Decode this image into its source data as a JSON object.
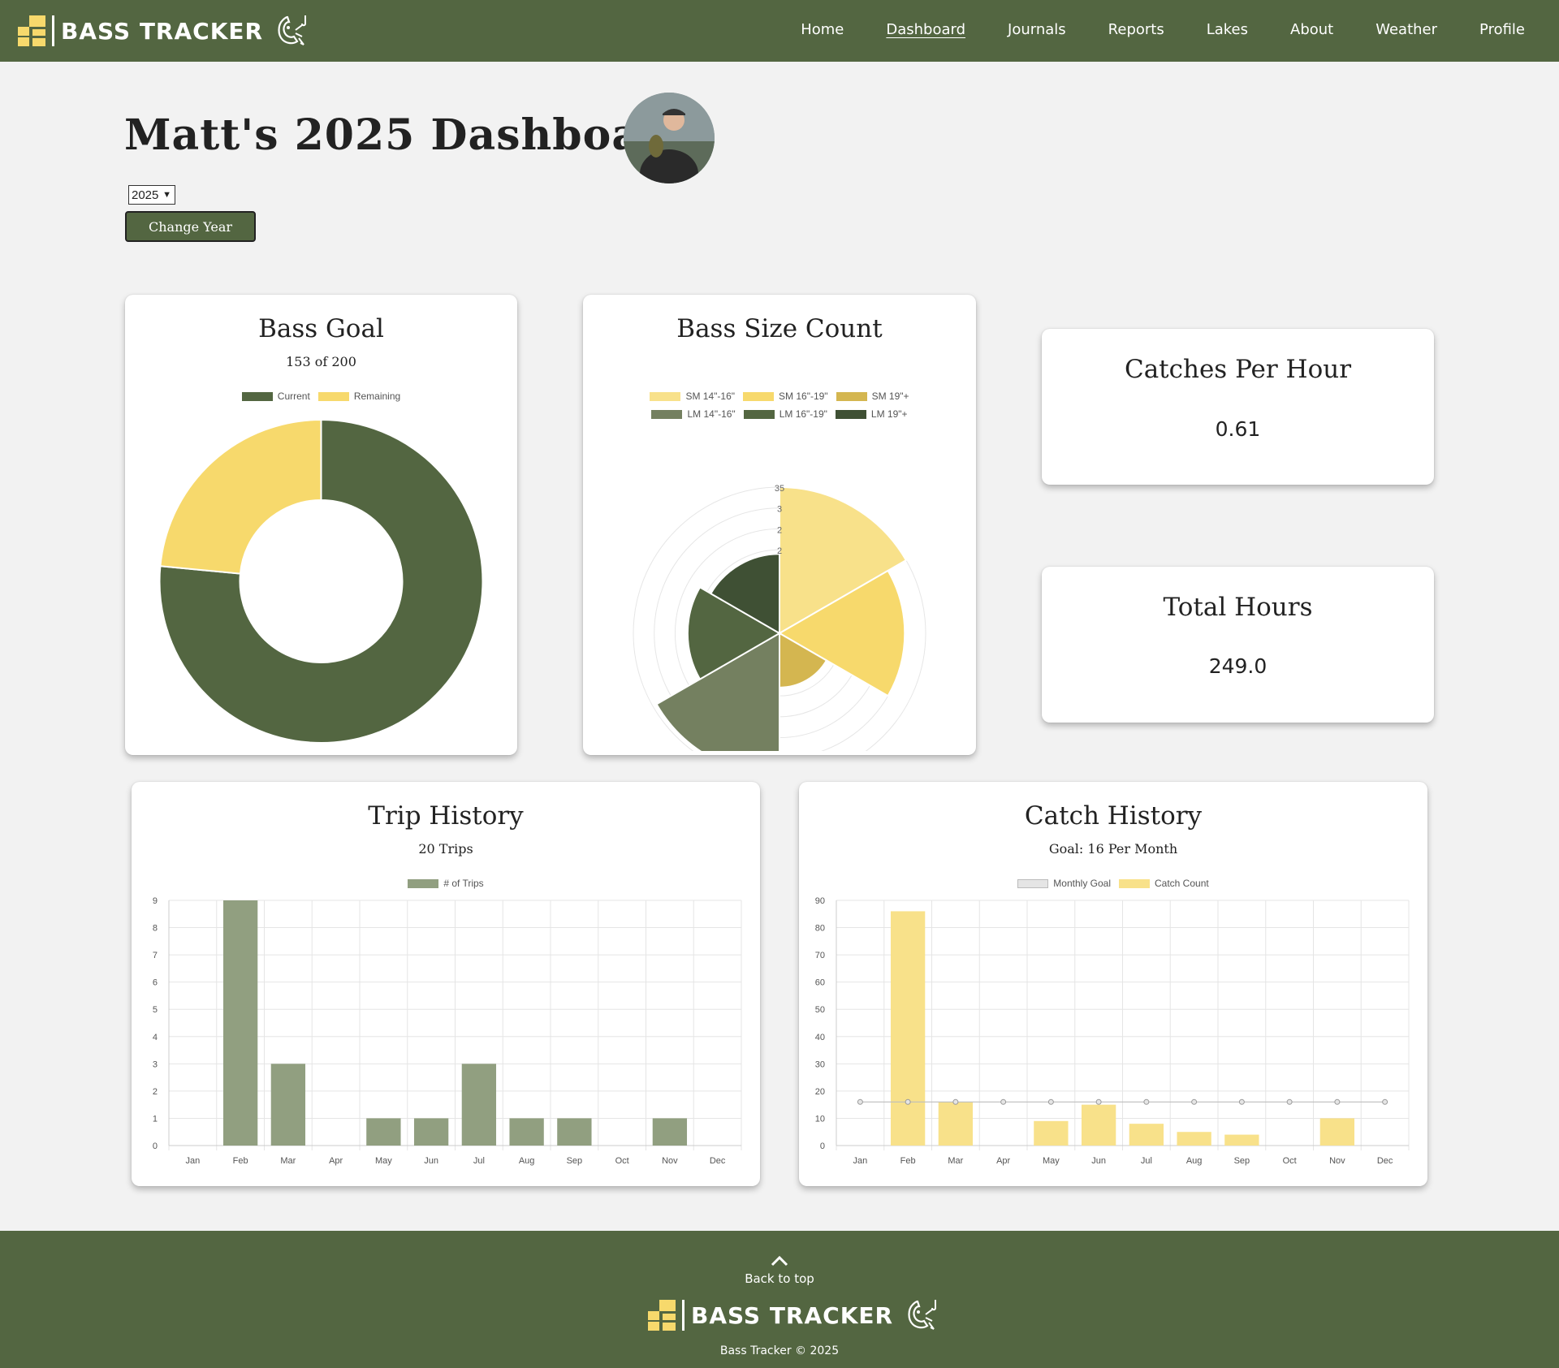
{
  "brand": {
    "name": "BASS TRACKER"
  },
  "nav": {
    "items": [
      {
        "label": "Home",
        "active": false
      },
      {
        "label": "Dashboard",
        "active": true
      },
      {
        "label": "Journals",
        "active": false
      },
      {
        "label": "Reports",
        "active": false
      },
      {
        "label": "Lakes",
        "active": false
      },
      {
        "label": "About",
        "active": false
      },
      {
        "label": "Weather",
        "active": false
      },
      {
        "label": "Profile",
        "active": false
      }
    ]
  },
  "header": {
    "title": "Matt's 2025 Dashboard",
    "year_value": "2025",
    "change_button": "Change Year"
  },
  "colors": {
    "primary_green": "#536641",
    "yellow": "#f7d96c",
    "light_yellow": "#f8e18a",
    "gold": "#d4b650",
    "sage": "#748060",
    "dark_green": "#3f5034",
    "trip_bar": "#919f80"
  },
  "cards": {
    "bass_goal": {
      "title": "Bass Goal",
      "subtitle": "153 of 200"
    },
    "bass_size": {
      "title": "Bass Size Count"
    },
    "catches_per_hour": {
      "title": "Catches Per Hour",
      "value": "0.61"
    },
    "total_hours": {
      "title": "Total Hours",
      "value": "249.0"
    },
    "trip_history": {
      "title": "Trip History",
      "subtitle": "20 Trips"
    },
    "catch_history": {
      "title": "Catch History",
      "subtitle": "Goal: 16 Per Month"
    }
  },
  "chart_data": [
    {
      "id": "bass_goal",
      "type": "pie",
      "variant": "doughnut",
      "labels": [
        "Current",
        "Remaining"
      ],
      "values": [
        153,
        47
      ],
      "colors": [
        "#536641",
        "#f7d96c"
      ],
      "legend": "top"
    },
    {
      "id": "bass_size",
      "type": "pie",
      "variant": "polar-area",
      "labels": [
        "SM 14\"-16\"",
        "SM 16\"-19\"",
        "SM 19\"+",
        "LM 14\"-16\"",
        "LM 16\"-19\"",
        "LM 19\"+"
      ],
      "values": [
        35,
        30,
        13,
        34,
        22,
        19
      ],
      "colors": [
        "#f8e18a",
        "#f7d96c",
        "#d4b650",
        "#748060",
        "#536641",
        "#3f5034"
      ],
      "rlim": [
        0,
        35
      ],
      "r_ticks": [
        "35",
        "3",
        "2",
        "2"
      ],
      "legend": "top"
    },
    {
      "id": "trip_history",
      "type": "bar",
      "categories": [
        "Jan",
        "Feb",
        "Mar",
        "Apr",
        "May",
        "Jun",
        "Jul",
        "Aug",
        "Sep",
        "Oct",
        "Nov",
        "Dec"
      ],
      "series": [
        {
          "name": "# of Trips",
          "values": [
            0,
            9,
            3,
            0,
            1,
            1,
            3,
            1,
            1,
            0,
            1,
            0
          ]
        }
      ],
      "ylim": [
        0,
        9
      ],
      "yticks": [
        0,
        1,
        2,
        3,
        4,
        5,
        6,
        7,
        8,
        9
      ],
      "grid": true,
      "legend": "top"
    },
    {
      "id": "catch_history",
      "type": "bar",
      "categories": [
        "Jan",
        "Feb",
        "Mar",
        "Apr",
        "May",
        "Jun",
        "Jul",
        "Aug",
        "Sep",
        "Oct",
        "Nov",
        "Dec"
      ],
      "series": [
        {
          "name": "Monthly Goal",
          "kind": "line",
          "values": [
            16,
            16,
            16,
            16,
            16,
            16,
            16,
            16,
            16,
            16,
            16,
            16
          ]
        },
        {
          "name": "Catch Count",
          "kind": "bar",
          "values": [
            0,
            86,
            16,
            0,
            9,
            15,
            8,
            5,
            4,
            0,
            10,
            0
          ]
        }
      ],
      "ylim": [
        0,
        90
      ],
      "yticks": [
        0,
        10,
        20,
        30,
        40,
        50,
        60,
        70,
        80,
        90
      ],
      "grid": true,
      "legend": "top"
    }
  ],
  "footer": {
    "back_to_top": "Back to top",
    "brand": "BASS TRACKER",
    "copyright": "Bass Tracker © 2025"
  }
}
